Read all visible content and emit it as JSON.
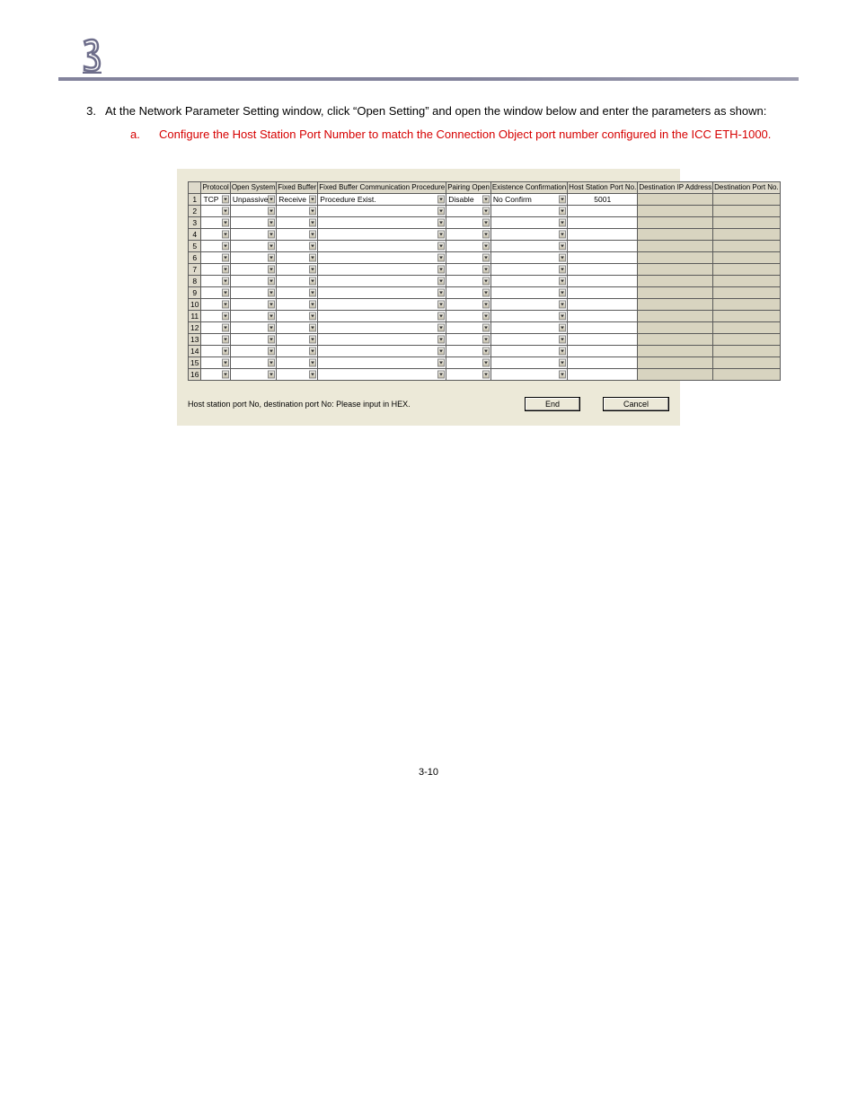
{
  "chapter_number_glyph": "3",
  "step": {
    "number": "3.",
    "text": "At the Network Parameter Setting window, click “Open Setting” and open the window below and enter the parameters as shown:"
  },
  "substep": {
    "letter": "a.",
    "text": "Configure the Host Station Port Number to match the Connection Object port number configured in the ICC ETH-1000."
  },
  "table": {
    "headers": [
      "",
      "Protocol",
      "Open System",
      "Fixed Buffer",
      "Fixed Buffer Communication Procedure",
      "Pairing Open",
      "Existence Confirmation",
      "Host Station Port No.",
      "Destination IP Address",
      "Destination Port No."
    ],
    "rows": [
      {
        "n": "1",
        "protocol": "TCP",
        "opensys": "Unpassive",
        "fixedbuf": "Receive",
        "proc": "Procedure Exist.",
        "pairing": "Disable",
        "exist": "No Confirm",
        "hostport": "5001",
        "destip": "",
        "destport": ""
      },
      {
        "n": "2",
        "protocol": "",
        "opensys": "",
        "fixedbuf": "",
        "proc": "",
        "pairing": "",
        "exist": "",
        "hostport": "",
        "destip": "",
        "destport": ""
      },
      {
        "n": "3",
        "protocol": "",
        "opensys": "",
        "fixedbuf": "",
        "proc": "",
        "pairing": "",
        "exist": "",
        "hostport": "",
        "destip": "",
        "destport": ""
      },
      {
        "n": "4",
        "protocol": "",
        "opensys": "",
        "fixedbuf": "",
        "proc": "",
        "pairing": "",
        "exist": "",
        "hostport": "",
        "destip": "",
        "destport": ""
      },
      {
        "n": "5",
        "protocol": "",
        "opensys": "",
        "fixedbuf": "",
        "proc": "",
        "pairing": "",
        "exist": "",
        "hostport": "",
        "destip": "",
        "destport": ""
      },
      {
        "n": "6",
        "protocol": "",
        "opensys": "",
        "fixedbuf": "",
        "proc": "",
        "pairing": "",
        "exist": "",
        "hostport": "",
        "destip": "",
        "destport": ""
      },
      {
        "n": "7",
        "protocol": "",
        "opensys": "",
        "fixedbuf": "",
        "proc": "",
        "pairing": "",
        "exist": "",
        "hostport": "",
        "destip": "",
        "destport": ""
      },
      {
        "n": "8",
        "protocol": "",
        "opensys": "",
        "fixedbuf": "",
        "proc": "",
        "pairing": "",
        "exist": "",
        "hostport": "",
        "destip": "",
        "destport": ""
      },
      {
        "n": "9",
        "protocol": "",
        "opensys": "",
        "fixedbuf": "",
        "proc": "",
        "pairing": "",
        "exist": "",
        "hostport": "",
        "destip": "",
        "destport": ""
      },
      {
        "n": "10",
        "protocol": "",
        "opensys": "",
        "fixedbuf": "",
        "proc": "",
        "pairing": "",
        "exist": "",
        "hostport": "",
        "destip": "",
        "destport": ""
      },
      {
        "n": "11",
        "protocol": "",
        "opensys": "",
        "fixedbuf": "",
        "proc": "",
        "pairing": "",
        "exist": "",
        "hostport": "",
        "destip": "",
        "destport": ""
      },
      {
        "n": "12",
        "protocol": "",
        "opensys": "",
        "fixedbuf": "",
        "proc": "",
        "pairing": "",
        "exist": "",
        "hostport": "",
        "destip": "",
        "destport": ""
      },
      {
        "n": "13",
        "protocol": "",
        "opensys": "",
        "fixedbuf": "",
        "proc": "",
        "pairing": "",
        "exist": "",
        "hostport": "",
        "destip": "",
        "destport": ""
      },
      {
        "n": "14",
        "protocol": "",
        "opensys": "",
        "fixedbuf": "",
        "proc": "",
        "pairing": "",
        "exist": "",
        "hostport": "",
        "destip": "",
        "destport": ""
      },
      {
        "n": "15",
        "protocol": "",
        "opensys": "",
        "fixedbuf": "",
        "proc": "",
        "pairing": "",
        "exist": "",
        "hostport": "",
        "destip": "",
        "destport": ""
      },
      {
        "n": "16",
        "protocol": "",
        "opensys": "",
        "fixedbuf": "",
        "proc": "",
        "pairing": "",
        "exist": "",
        "hostport": "",
        "destip": "",
        "destport": ""
      }
    ],
    "hint": "Host station port No, destination port No: Please input in HEX.",
    "buttons": {
      "end": "End",
      "cancel": "Cancel"
    }
  },
  "page_number": "3-10",
  "colors": {
    "red": "#d60000",
    "panel": "#ece9d8"
  }
}
